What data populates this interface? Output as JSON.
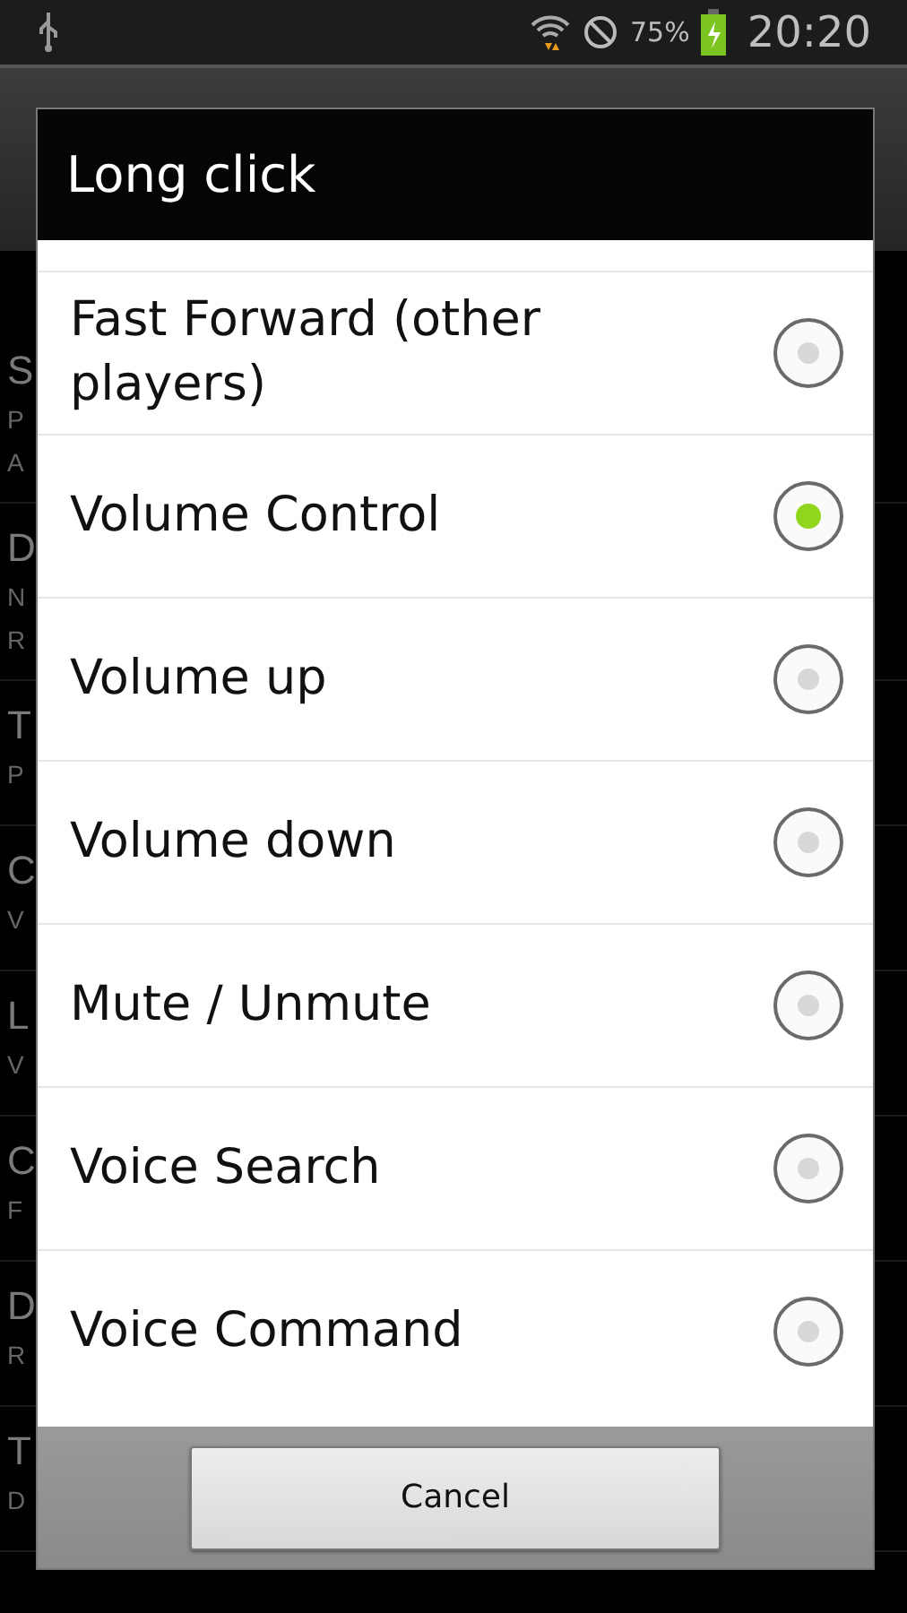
{
  "status_bar": {
    "battery": "75%",
    "time": "20:20"
  },
  "background_list": [
    {
      "title": "S",
      "lines": [
        "P",
        "A"
      ]
    },
    {
      "title": "D",
      "lines": [
        "N",
        "R"
      ]
    },
    {
      "title": "T",
      "lines": [
        "P"
      ]
    },
    {
      "title": "C",
      "lines": [
        "V"
      ]
    },
    {
      "title": "L",
      "lines": [
        "V"
      ]
    },
    {
      "title": "C",
      "lines": [
        "F"
      ]
    },
    {
      "title": "D",
      "lines": [
        "R"
      ]
    },
    {
      "title": "T",
      "lines": [
        "D"
      ]
    }
  ],
  "dialog": {
    "title": "Long click",
    "options": [
      {
        "label": "Fast Forward (other players)",
        "selected": false
      },
      {
        "label": "Volume Control",
        "selected": true
      },
      {
        "label": "Volume up",
        "selected": false
      },
      {
        "label": "Volume down",
        "selected": false
      },
      {
        "label": "Mute / Unmute",
        "selected": false
      },
      {
        "label": "Voice Search",
        "selected": false
      },
      {
        "label": "Voice Command",
        "selected": false
      }
    ],
    "buttons": [
      "Cancel"
    ]
  }
}
